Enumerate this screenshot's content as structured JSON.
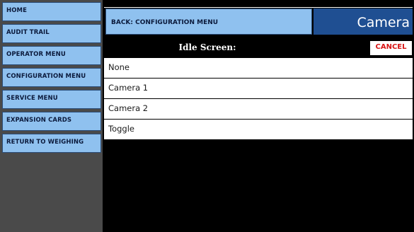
{
  "sidebar": {
    "items": [
      {
        "label": "HOME"
      },
      {
        "label": "AUDIT TRAIL"
      },
      {
        "label": "OPERATOR MENU"
      },
      {
        "label": "CONFIGURATION MENU"
      },
      {
        "label": "SERVICE MENU"
      },
      {
        "label": "EXPANSION CARDS"
      },
      {
        "label": "RETURN TO WEIGHING"
      }
    ]
  },
  "header": {
    "back_label": "BACK: CONFIGURATION MENU",
    "title": "Camera"
  },
  "subheader": {
    "title": "Idle Screen:",
    "cancel_label": "CANCEL"
  },
  "options": [
    {
      "label": "None"
    },
    {
      "label": "Camera 1"
    },
    {
      "label": "Camera 2"
    },
    {
      "label": "Toggle"
    }
  ],
  "colors": {
    "button_blue": "#8fc1ef",
    "title_blue": "#1f4f92",
    "cancel_red": "#d81414"
  }
}
